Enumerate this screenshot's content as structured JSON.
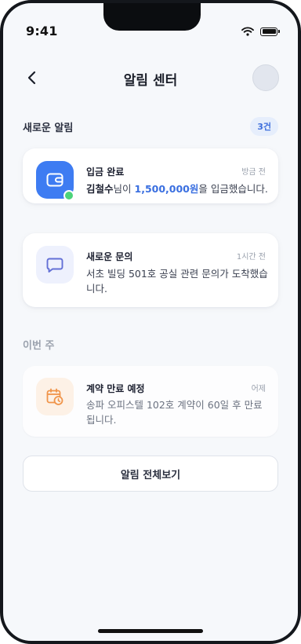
{
  "status": {
    "time": "9:41"
  },
  "header": {
    "title": "알림 센터"
  },
  "new_section": {
    "title": "새로운 알림",
    "count": "3건"
  },
  "week_section": {
    "title": "이번 주"
  },
  "notifications": [
    {
      "title": "입금 완료",
      "time": "방금 전",
      "name": "김철수",
      "text_a": "님이 ",
      "amount": "1,500,000원",
      "text_b": "을 입금했습니다."
    },
    {
      "title": "새로운 문의",
      "time": "1시간 전",
      "body": "서초 빌딩 501호 공실 관련 문의가 도착했습니다."
    },
    {
      "title": "계약 만료 예정",
      "time": "어제",
      "body": "송파 오피스텔 102호 계약이 60일 후 만료됩니다."
    }
  ],
  "footer": {
    "view_all_label": "알림 전체보기"
  },
  "icons": {
    "back": "chevron-left-icon",
    "wallet": "wallet-icon",
    "chat": "chat-bubble-icon",
    "calendar": "calendar-clock-icon"
  },
  "colors": {
    "accent": "#3e7cf2",
    "online": "#4cd37a",
    "amount": "#3a6fe0",
    "chat_icon": "#6370d6",
    "calendar_icon": "#f0944a"
  }
}
